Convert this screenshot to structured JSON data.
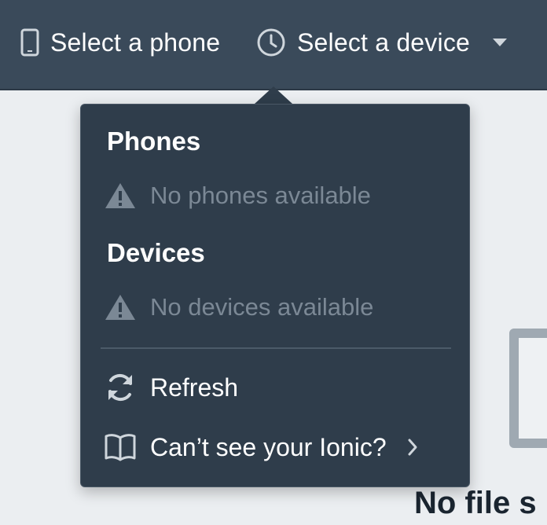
{
  "topbar": {
    "phone_label": "Select a phone",
    "phone_icon": "smartphone-icon",
    "device_label": "Select a device",
    "device_icon": "clock-icon",
    "caret_icon": "caret-down-icon"
  },
  "dropdown": {
    "phones": {
      "title": "Phones",
      "empty_text": "No phones available",
      "empty_icon": "warning-icon"
    },
    "devices": {
      "title": "Devices",
      "empty_text": "No devices available",
      "empty_icon": "warning-icon"
    },
    "refresh": {
      "label": "Refresh",
      "icon": "refresh-icon"
    },
    "help": {
      "label": "Can’t see your Ionic?",
      "icon": "book-icon",
      "chevron_icon": "chevron-right-icon"
    }
  },
  "background": {
    "heading": "No file s"
  },
  "colors": {
    "topbar_bg": "#3a4a5a",
    "menu_bg": "#2f3d4b",
    "muted_text": "#7b8895",
    "page_bg": "#ebeef1"
  }
}
